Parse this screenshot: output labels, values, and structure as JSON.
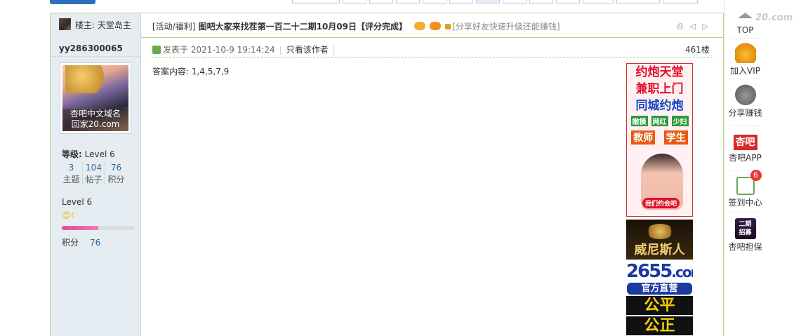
{
  "top": {
    "pager_cells": 13
  },
  "author": {
    "badge_label": "楼主: 天堂岛主",
    "username": "yy286300065",
    "avatar_watermark_line1": "杏吧中文域名",
    "avatar_watermark_line2": "回家20.com",
    "level_label": "等级:",
    "level_value": "Level 6",
    "stats": [
      {
        "value": "3",
        "label": "主题"
      },
      {
        "value": "104",
        "label": "帖子"
      },
      {
        "value": "76",
        "label": "积分"
      }
    ],
    "level_name": "Level 6",
    "level_emoji": "😊☾",
    "progress_fraction": 0.5,
    "points_label": "积分",
    "points_value": "76"
  },
  "thread": {
    "category": "[活动/福利]",
    "title": "图吧大家来找茬第一百二十二期10月09日【评分完成】",
    "share_text": "[分享好友快速升级还能赚钱]",
    "title_icons": "⎙ ◁ ▷"
  },
  "post": {
    "posted_label": "发表于 2021-10-9 19:14:24",
    "only_author_label": "只看该作者",
    "floor": "461楼",
    "content": "答案内容: 1,4,5,7,9"
  },
  "ads": {
    "ad1_lines": [
      "约炮天堂",
      "兼职上门",
      "同城约炮"
    ],
    "ad1_tags": [
      "嫩模",
      "网红",
      "少妇"
    ],
    "ad1_tags2": [
      "教师",
      "学生"
    ],
    "ad1_pill": "我们约会吧",
    "ad2_text": "威尼斯人",
    "ad3_num": "2655",
    "ad3_domain": ".com",
    "ad3_banner": "官方直营",
    "ad3_big1": "公平",
    "ad3_big2": "公正"
  },
  "right_bar": {
    "items": [
      {
        "label": "TOP",
        "icon": "arrow-up-icon"
      },
      {
        "label": "加入VIP",
        "icon": "crown-icon"
      },
      {
        "label": "分享赚钱",
        "icon": "money-bag-icon"
      },
      {
        "label": "杏吧APP",
        "icon": "app-logo-icon",
        "icon_text": "杏吧"
      },
      {
        "label": "签到中心",
        "icon": "sign-in-icon",
        "badge": "6"
      },
      {
        "label": "杏吧担保",
        "icon": "guarantee-icon",
        "icon_text": "二期\n招募"
      }
    ]
  },
  "watermark": "20.com"
}
